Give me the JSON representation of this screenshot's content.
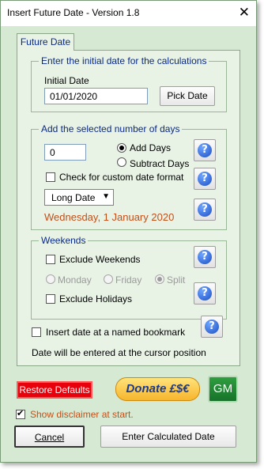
{
  "window": {
    "title": "Insert Future Date - Version 1.8",
    "close_symbol": "✕"
  },
  "tab": {
    "label": "Future Date"
  },
  "initial_date": {
    "frame_label": "Enter the initial date for the calculations",
    "field_label": "Initial Date",
    "value": "01/01/2020",
    "pick_button": "Pick Date"
  },
  "add_days": {
    "frame_label": "Add the selected number of days",
    "days_value": "0",
    "add_label": "Add Days",
    "subtract_label": "Subtract Days",
    "selected": "add",
    "custom_format_label": "Check for custom date format",
    "custom_format_checked": false,
    "format_value": "Long Date",
    "dropdown_arrow": "▼",
    "result": "Wednesday, 1 January 2020",
    "result_color": "#c0501a"
  },
  "weekends": {
    "frame_label": "Weekends",
    "exclude_weekends_label": "Exclude Weekends",
    "exclude_weekends_checked": false,
    "monday_label": "Monday",
    "friday_label": "Friday",
    "split_label": "Split",
    "selected": "split",
    "exclude_holidays_label": "Exclude Holidays",
    "exclude_holidays_checked": false
  },
  "bookmark": {
    "label": "Insert date at a named bookmark",
    "checked": false,
    "note": "Date will be entered at the cursor position"
  },
  "footer": {
    "restore_label": "Restore Defaults",
    "donate_label": "Donate £$€",
    "gm_label": "GM",
    "disclaimer_label": "Show disclaimer at start.",
    "disclaimer_checked": true,
    "cancel_label": "Cancel",
    "enter_label": "Enter Calculated Date"
  },
  "help_icon_symbol": "?",
  "colors": {
    "window_bg": "#d6ead3",
    "frame_label": "#0a2a8a",
    "restore_bg": "#e8000b",
    "gm_bg": "#17722a"
  }
}
